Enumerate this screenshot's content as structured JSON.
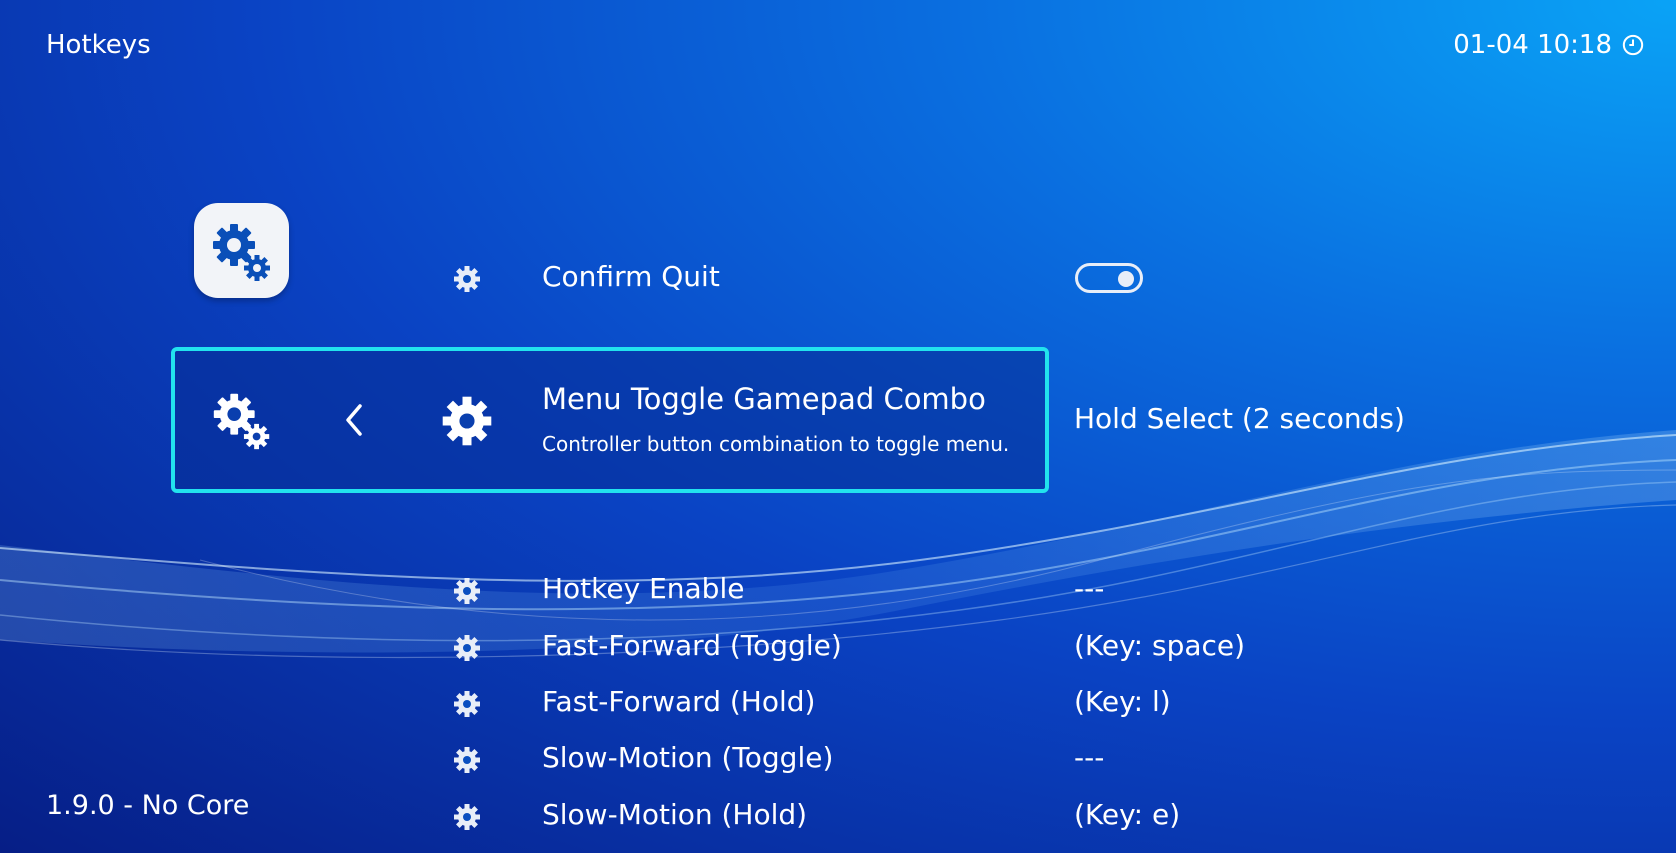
{
  "header": {
    "title": "Hotkeys",
    "datetime": "01-04 10:18"
  },
  "footer": {
    "version": "1.9.0 - No Core"
  },
  "colors": {
    "accent": "#22e3ee",
    "text": "#ffffff",
    "icon_tile": "#f2f4f8",
    "icon_blue": "#0a4fb8"
  },
  "icons": {
    "category": "settings-gears-icon",
    "row": "gear-icon",
    "back": "chevron-left-icon",
    "clock": "clock-icon"
  },
  "menu": {
    "confirm_quit": {
      "label": "Confirm Quit",
      "toggle_on": true
    },
    "selected": {
      "label": "Menu Toggle Gamepad Combo",
      "sublabel": "Controller button combination to toggle menu.",
      "value": "Hold Select (2 seconds)"
    },
    "items": [
      {
        "label": "Hotkey Enable",
        "value": "---"
      },
      {
        "label": "Fast-Forward (Toggle)",
        "value": "(Key: space)"
      },
      {
        "label": "Fast-Forward (Hold)",
        "value": "(Key: l)"
      },
      {
        "label": "Slow-Motion (Toggle)",
        "value": "---"
      },
      {
        "label": "Slow-Motion (Hold)",
        "value": "(Key: e)"
      }
    ]
  }
}
